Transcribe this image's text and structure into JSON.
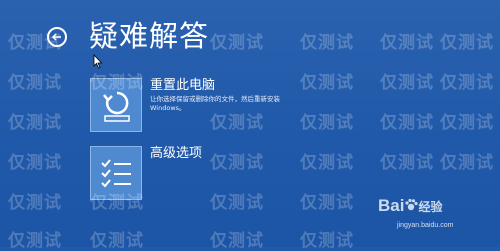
{
  "header": {
    "title": "疑难解答"
  },
  "options": [
    {
      "title": "重置此电脑",
      "description": "让你选择保留或删除你的文件，然后重新安装 Windows。",
      "icon": "reset-pc-icon"
    },
    {
      "title": "高级选项",
      "icon": "checklist-icon"
    }
  ],
  "watermark": {
    "text": "仅测试",
    "baidu_brand": "Bai",
    "baidu_brand_suffix": "经验",
    "site_url": "jingyan.baidu.com"
  },
  "colors": {
    "background": "#1f5bab",
    "tile": "#4f8ad1",
    "text": "#ffffff"
  }
}
